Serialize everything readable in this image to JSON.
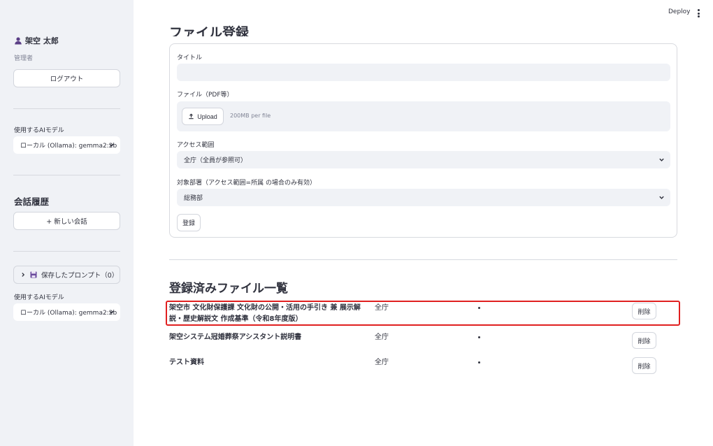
{
  "sidebar": {
    "user_name": "架空 太郎",
    "role": "管理者",
    "logout_label": "ログアウト",
    "model_label": "使用するAIモデル",
    "model_value": "ローカル (Ollama): gemma2:2b",
    "history_heading": "会話履歴",
    "new_chat_label": "+ 新しい会話",
    "saved_prompts_label": "保存したプロンプト（0）",
    "model_label_2": "使用するAIモデル",
    "model_value_2": "ローカル (Ollama): gemma2:2b"
  },
  "header": {
    "deploy_label": "Deploy"
  },
  "form": {
    "title": "ファイル登録",
    "title_label": "タイトル",
    "title_value": "",
    "file_label": "ファイル（PDF等）",
    "upload_label": "Upload",
    "upload_hint": "200MB per file",
    "access_label": "アクセス範囲",
    "access_value": "全庁（全員が参照可）",
    "dept_label": "対象部署（アクセス範囲=所属 の場合のみ有効）",
    "dept_value": "総務部",
    "register_label": "登録"
  },
  "list": {
    "heading": "登録済みファイル一覧",
    "delete_label": "削除",
    "rows": [
      {
        "name": "架空市 文化財保護課 文化財の公開・活用の手引き 兼 展示解説・歴史解説文 作成基準（令和8年度版）",
        "access": "全庁"
      },
      {
        "name": "架空システム冠婚葬祭アシスタント説明書",
        "access": "全庁"
      },
      {
        "name": "テスト資料",
        "access": "全庁"
      }
    ]
  },
  "colors": {
    "sidebar_bg": "#f0f2f6",
    "highlight": "#e02020",
    "text": "#31333f"
  }
}
